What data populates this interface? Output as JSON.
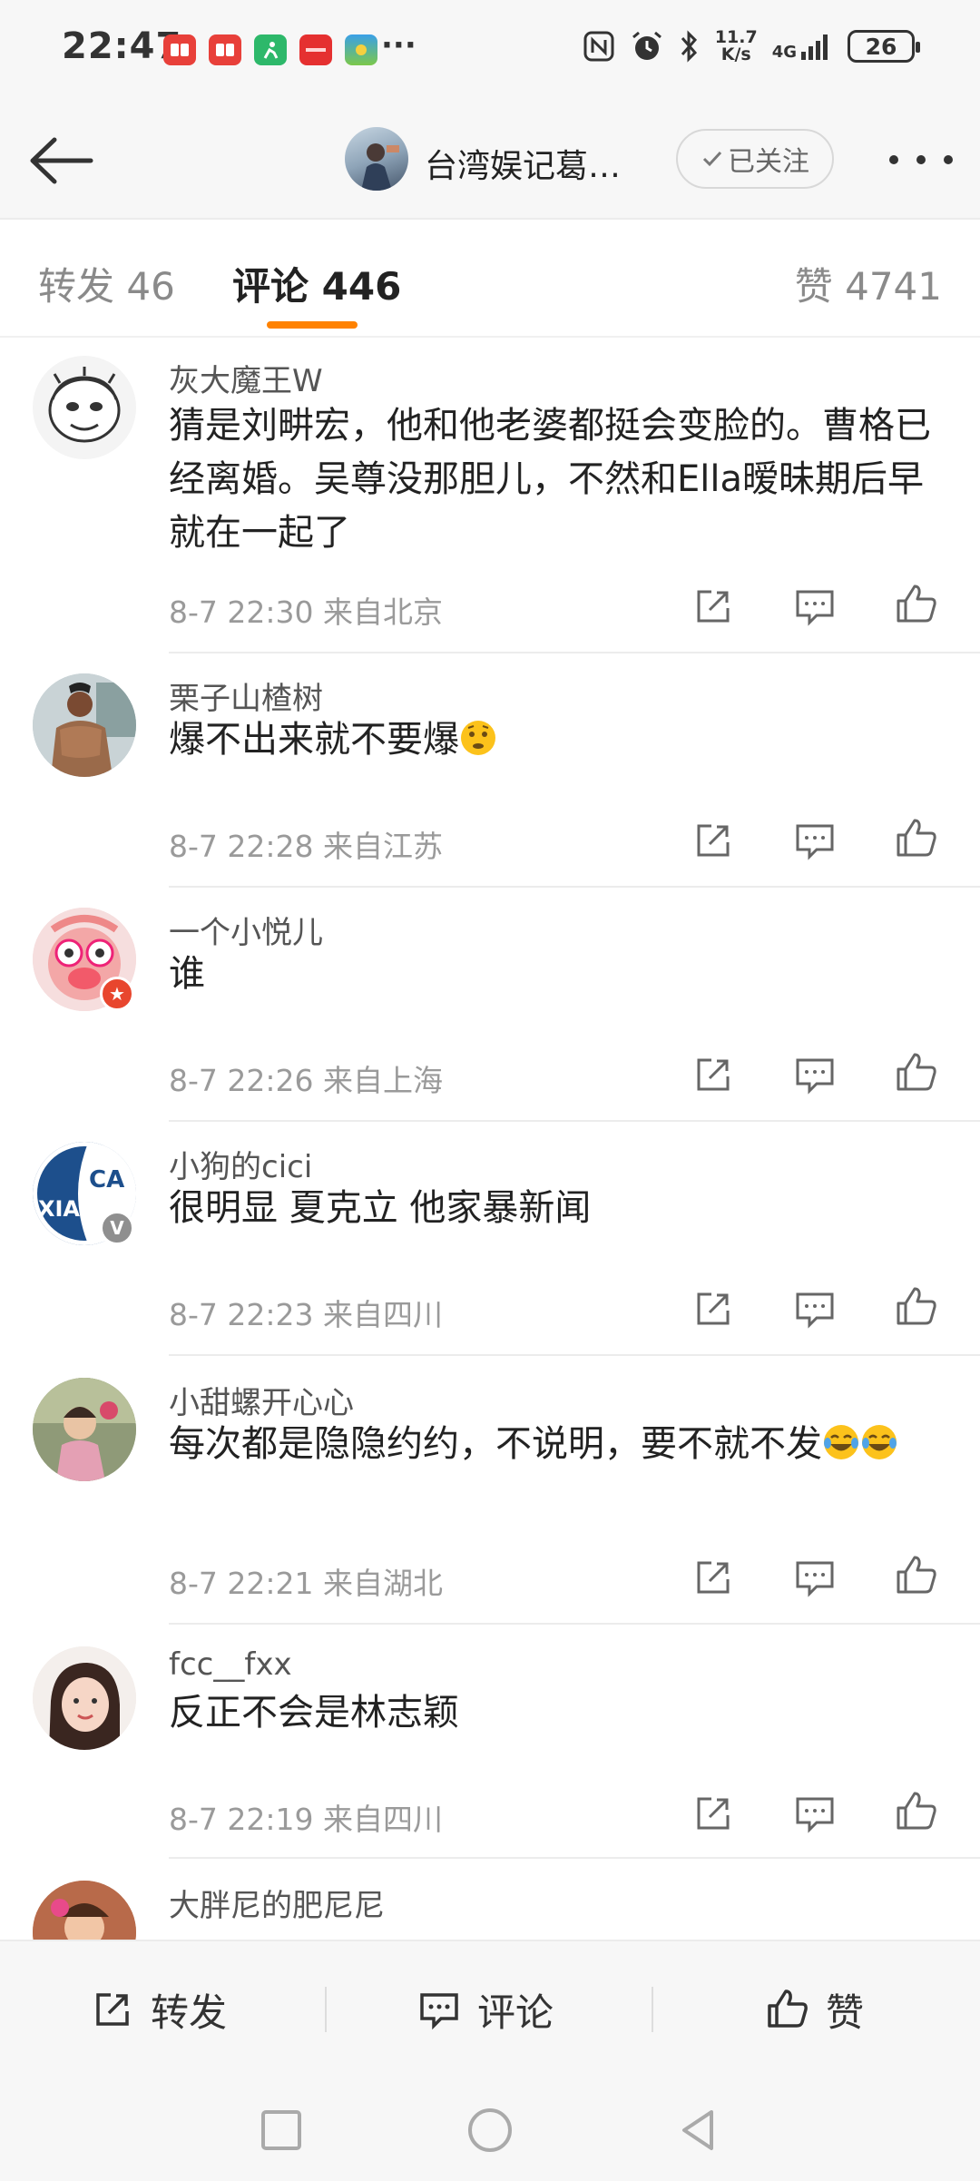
{
  "status_bar": {
    "time": "22:47",
    "more": "···",
    "speed_value": "11.7",
    "speed_unit": "K/s",
    "network": "4G",
    "battery": "26"
  },
  "header": {
    "title": "台湾娱记葛…",
    "follow_label": "已关注"
  },
  "tabs": {
    "repost": "转发 46",
    "comments": "评论 446",
    "likes": "赞 4741"
  },
  "comments": [
    {
      "name": "灰大魔王W",
      "text": "猜是刘畊宏，他和他老婆都挺会变脸的。曹格已经离婚。吴尊没那胆儿，不然和Ella暧昧期后早就在一起了",
      "meta": "8-7 22:30  来自北京"
    },
    {
      "name": "栗子山楂树",
      "text": "爆不出来就不要爆",
      "meta": "8-7 22:28  来自江苏"
    },
    {
      "name": "一个小悦儿",
      "text": "谁",
      "meta": "8-7 22:26  来自上海"
    },
    {
      "name": "小狗的cici",
      "text": "很明显 夏克立 他家暴新闻",
      "meta": "8-7 22:23  来自四川",
      "avatar_text": "CA XIA"
    },
    {
      "name": "小甜螺开心心",
      "text": "每次都是隐隐约约，不说明，要不就不发",
      "meta": "8-7 22:21  来自湖北"
    },
    {
      "name": "fcc__fxx",
      "text": "反正不会是林志颖",
      "meta": "8-7 22:19  来自四川"
    },
    {
      "name": "大胖尼的肥尼尼"
    }
  ],
  "bottom_bar": {
    "repost": "转发",
    "comment": "评论",
    "like": "赞"
  },
  "colors": {
    "accent": "#ff8200",
    "badge_red": "#e8462e",
    "badge_gray": "#8f8f8f"
  },
  "icons": [
    "back-arrow-icon",
    "check-icon",
    "share-icon",
    "comment-icon",
    "like-icon",
    "square-nav-icon",
    "circle-nav-icon",
    "triangle-nav-icon"
  ]
}
